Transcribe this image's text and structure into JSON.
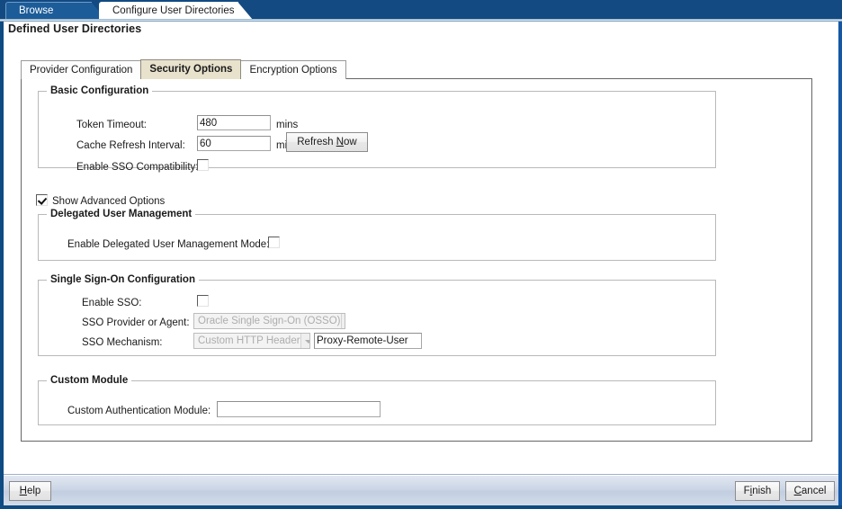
{
  "window": {
    "tabs": [
      {
        "label": "Browse",
        "active": false
      },
      {
        "label": "Configure User Directories",
        "active": true
      }
    ]
  },
  "page": {
    "heading": "Defined User Directories"
  },
  "inner_tabs": [
    {
      "label": "Provider Configuration",
      "selected": false
    },
    {
      "label": "Security Options",
      "selected": true
    },
    {
      "label": "Encryption Options",
      "selected": false
    }
  ],
  "basic_configuration": {
    "title": "Basic Configuration",
    "token_timeout": {
      "label": "Token Timeout:",
      "value": "480",
      "unit": "mins"
    },
    "cache_refresh_interval": {
      "label": "Cache Refresh Interval:",
      "value": "60",
      "unit": "mins"
    },
    "refresh_now_button": {
      "before": "Refresh ",
      "mnemonic": "N",
      "after": "ow"
    },
    "enable_sso_compatibility": {
      "label": "Enable SSO Compatibility:",
      "checked": false
    }
  },
  "show_advanced_options": {
    "label": "Show Advanced Options",
    "checked": true
  },
  "delegated_user_management": {
    "title": "Delegated User Management",
    "enable_mode": {
      "label": "Enable Delegated User Management Mode:",
      "checked": false
    }
  },
  "single_sign_on": {
    "title": "Single Sign-On Configuration",
    "enable_sso": {
      "label": "Enable SSO:",
      "checked": false
    },
    "provider_or_agent": {
      "label": "SSO Provider or Agent:",
      "value": "Oracle Single Sign-On (OSSO)",
      "disabled": true
    },
    "mechanism": {
      "label": "SSO Mechanism:",
      "value": "Custom HTTP Header",
      "disabled": true
    },
    "mechanism_header": {
      "value": "Proxy-Remote-User"
    }
  },
  "custom_module": {
    "title": "Custom Module",
    "authentication_module": {
      "label": "Custom Authentication Module:",
      "value": "",
      "placeholder": ""
    }
  },
  "command_bar": {
    "help": {
      "mnemonic": "H",
      "after": "elp"
    },
    "finish": {
      "before": "F",
      "mnemonic": "i",
      "after": "nish"
    },
    "cancel": {
      "mnemonic": "C",
      "after": "ancel"
    }
  }
}
